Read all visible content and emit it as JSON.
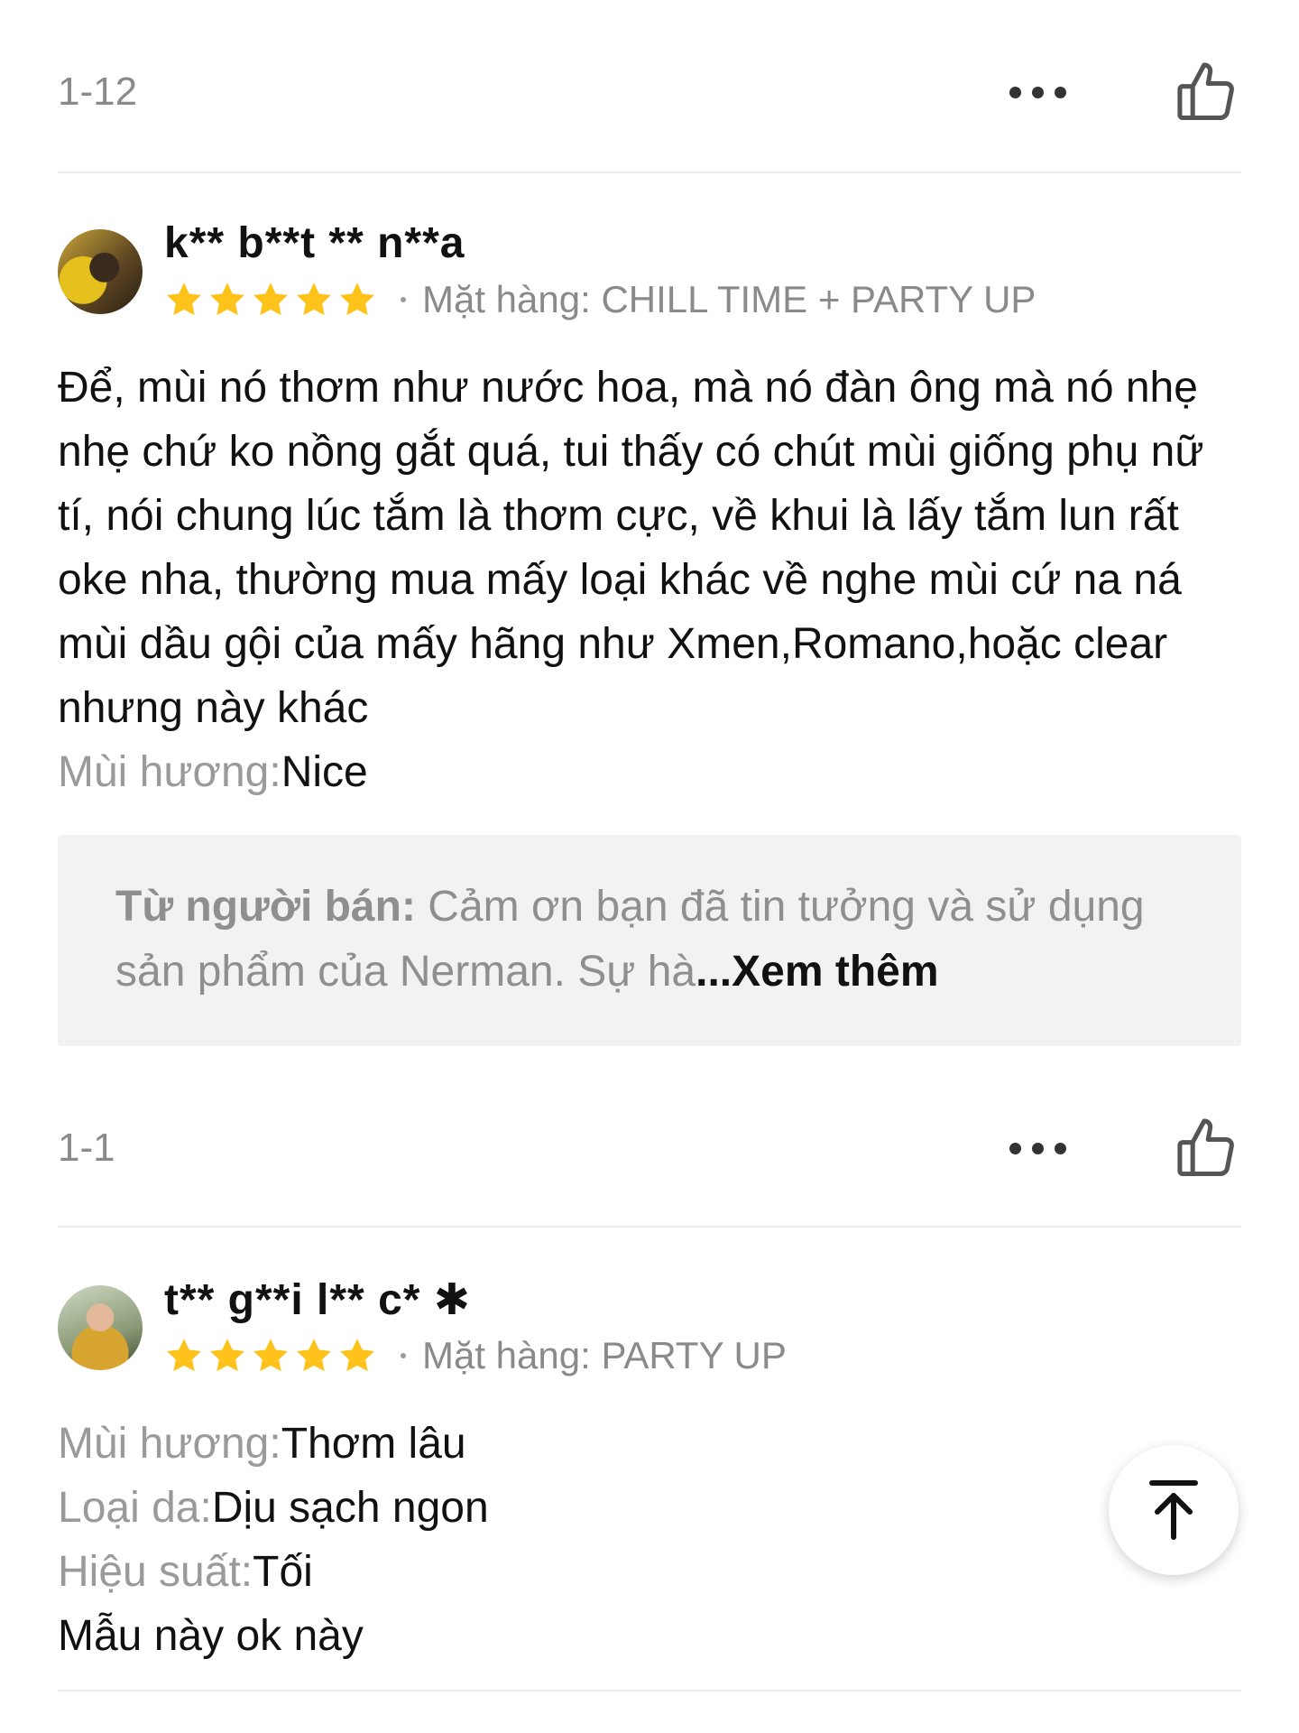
{
  "reviews": [
    {
      "date": "1-12",
      "username": "k** b**t ** n**a",
      "rating": 5,
      "variant": "Mặt hàng: CHILL TIME + PARTY UP",
      "comment": "Để, mùi nó thơm như nước hoa, mà nó đàn ông mà nó nhẹ nhẹ chứ ko nồng gắt quá, tui thấy có chút mùi giống phụ nữ tí, nói chung lúc tắm là thơm cực, về khui là lấy tắm lun rất oke nha, thường mua mấy loại khác về nghe mùi cứ na ná mùi dầu gội của mấy hãng như Xmen,Romano,hoặc clear nhưng này khác",
      "attributes": [
        {
          "label": "Mùi hương:",
          "value": "Nice"
        }
      ],
      "seller_reply": {
        "label": "Từ người bán:",
        "text": " Cảm ơn bạn đã tin tưởng và sử dụng sản phẩm của Nerman. Sự hà",
        "more": "...Xem thêm"
      },
      "reply_date": "1-1"
    },
    {
      "username": "t** g**i l** c* ✱",
      "rating": 5,
      "variant": "Mặt hàng: PARTY UP",
      "attributes": [
        {
          "label": "Mùi hương:",
          "value": "Thơm lâu"
        },
        {
          "label": "Loại da:",
          "value": "Dịu sạch ngon"
        },
        {
          "label": "Hiệu suất:",
          "value": "Tối"
        }
      ],
      "comment": "Mẫu này ok này"
    }
  ],
  "icons": {
    "more": "more-horizontal-icon",
    "like": "thumbs-up-icon",
    "star": "star-icon",
    "back_to_top": "arrow-up-to-top-icon"
  },
  "colors": {
    "star": "#FFC21A",
    "muted_text": "#8a8a8a",
    "seller_box_bg": "#f2f2f2"
  }
}
